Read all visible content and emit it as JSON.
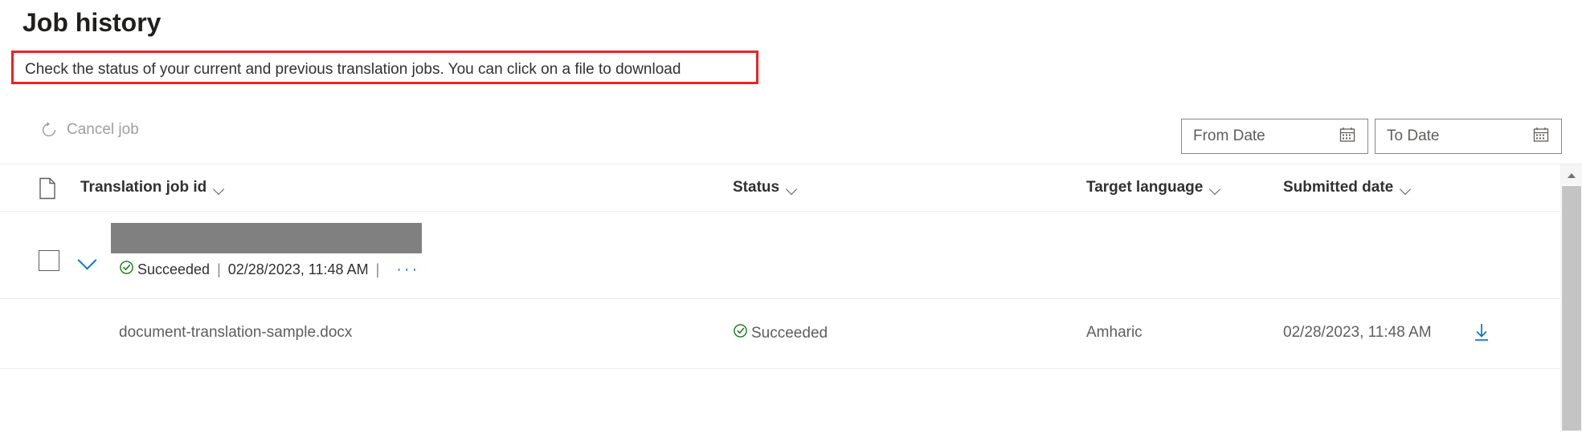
{
  "page": {
    "title": "Job history",
    "description": "Check the status of your current and previous translation jobs. You can click on a file to download",
    "annotation_color": "#ee2222"
  },
  "command_bar": {
    "cancel_job_label": "Cancel job",
    "cancel_job_icon": "cancel-circle-icon",
    "cancel_job_disabled": true,
    "from_date": {
      "placeholder": "From Date",
      "value": "",
      "icon": "calendar-icon"
    },
    "to_date": {
      "placeholder": "To Date",
      "value": "",
      "icon": "calendar-icon"
    }
  },
  "table": {
    "columns": [
      {
        "key": "job_id",
        "label": "Translation job id",
        "sortable": true
      },
      {
        "key": "status",
        "label": "Status",
        "sortable": true
      },
      {
        "key": "target_language",
        "label": "Target language",
        "sortable": true
      },
      {
        "key": "submitted_date",
        "label": "Submitted date",
        "sortable": true
      }
    ],
    "header_icon": "document-icon",
    "group_row": {
      "checkbox_checked": false,
      "expanded": true,
      "job_id_redacted": true,
      "status": "Succeeded",
      "status_icon": "check-circle-icon",
      "status_color": "#107c10",
      "separator": "|",
      "submitted_date": "02/28/2023, 11:48 AM",
      "more_options": "···"
    },
    "rows": [
      {
        "file_name": "document-translation-sample.docx",
        "status": "Succeeded",
        "status_icon": "check-circle-icon",
        "target_language": "Amharic",
        "submitted_date": "02/28/2023, 11:48 AM",
        "download_icon": "download-icon"
      }
    ]
  },
  "scrollbar": {
    "up_arrow_icon": "caret-up-icon",
    "orientation": "vertical"
  },
  "colors": {
    "accent": "#0078d4",
    "success": "#107c10",
    "text": "#323130",
    "secondary_text": "#605e5c",
    "border": "#edebe9",
    "redaction": "#808080"
  }
}
